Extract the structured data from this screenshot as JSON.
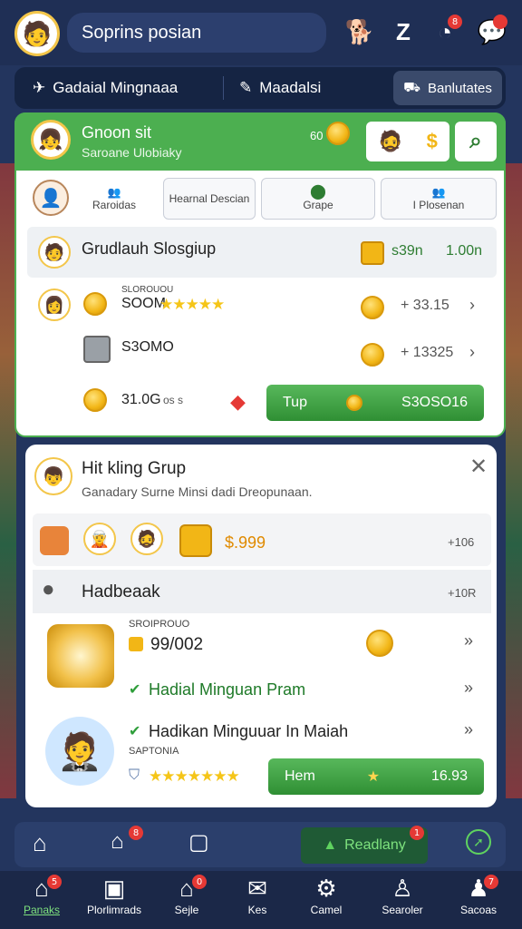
{
  "topbar": {
    "search_text": "Soprins posian",
    "badges": [
      "8",
      ""
    ]
  },
  "secnav": {
    "item1": "Gadaial Mingnaaa",
    "item2": "Maadalsi",
    "item3": "Banlutates"
  },
  "group_card": {
    "title": "Gnoon sit",
    "subtitle": "Saroane Ulobiaky",
    "badge_value": "60",
    "tabs": [
      "Raroidas",
      "Hearnal Descian",
      "Grape",
      "I Plosenan"
    ],
    "row_header": {
      "name": "Grudlauh Slosgiup",
      "value1": "s39n",
      "value2": "1.00n"
    },
    "rows": [
      {
        "label": "SLOROUOU",
        "value": "SOOM",
        "right": "+ 33.15"
      },
      {
        "label": "",
        "value": "S3OMO",
        "right": "+ 13325"
      },
      {
        "label": "",
        "value": "31.0G",
        "right": ""
      }
    ],
    "rows_extra": {
      "row3_suffix": "os s"
    },
    "button": {
      "label": "Tup",
      "value": "S3OSO16"
    }
  },
  "hint_card": {
    "title": "Hit kling Grup",
    "subtitle": "Ganadary Surne Minsi dadi Dreopunaan.",
    "reward_value": "$.999",
    "reward_right": "+106",
    "section_title": "Hadbeaak",
    "section_right": "+10R",
    "item1": {
      "label": "SROIPROUO",
      "value": "99/002"
    },
    "item2": {
      "title": "Hadial Minguan Pram"
    },
    "item3": {
      "title": "Hadikan Minguuar In Maiah",
      "label": "SAPTONIA"
    },
    "button": {
      "label": "Hem",
      "value": "16.93"
    }
  },
  "subnav": {
    "badge1": "8",
    "ready_label": "Readlany",
    "ready_badge": "1"
  },
  "bottomnav": {
    "items": [
      {
        "label": "Panaks",
        "badge": "5"
      },
      {
        "label": "Plorlimrads",
        "badge": ""
      },
      {
        "label": "Sejle",
        "badge": "0"
      },
      {
        "label": "Kes",
        "badge": ""
      },
      {
        "label": "Camel",
        "badge": ""
      },
      {
        "label": "Searoler",
        "badge": ""
      },
      {
        "label": "Sacoas",
        "badge": "7"
      }
    ]
  },
  "colors": {
    "accent": "#4caf50",
    "nav": "#1f2f55",
    "badge": "#e53935",
    "gold": "#f2b616"
  }
}
